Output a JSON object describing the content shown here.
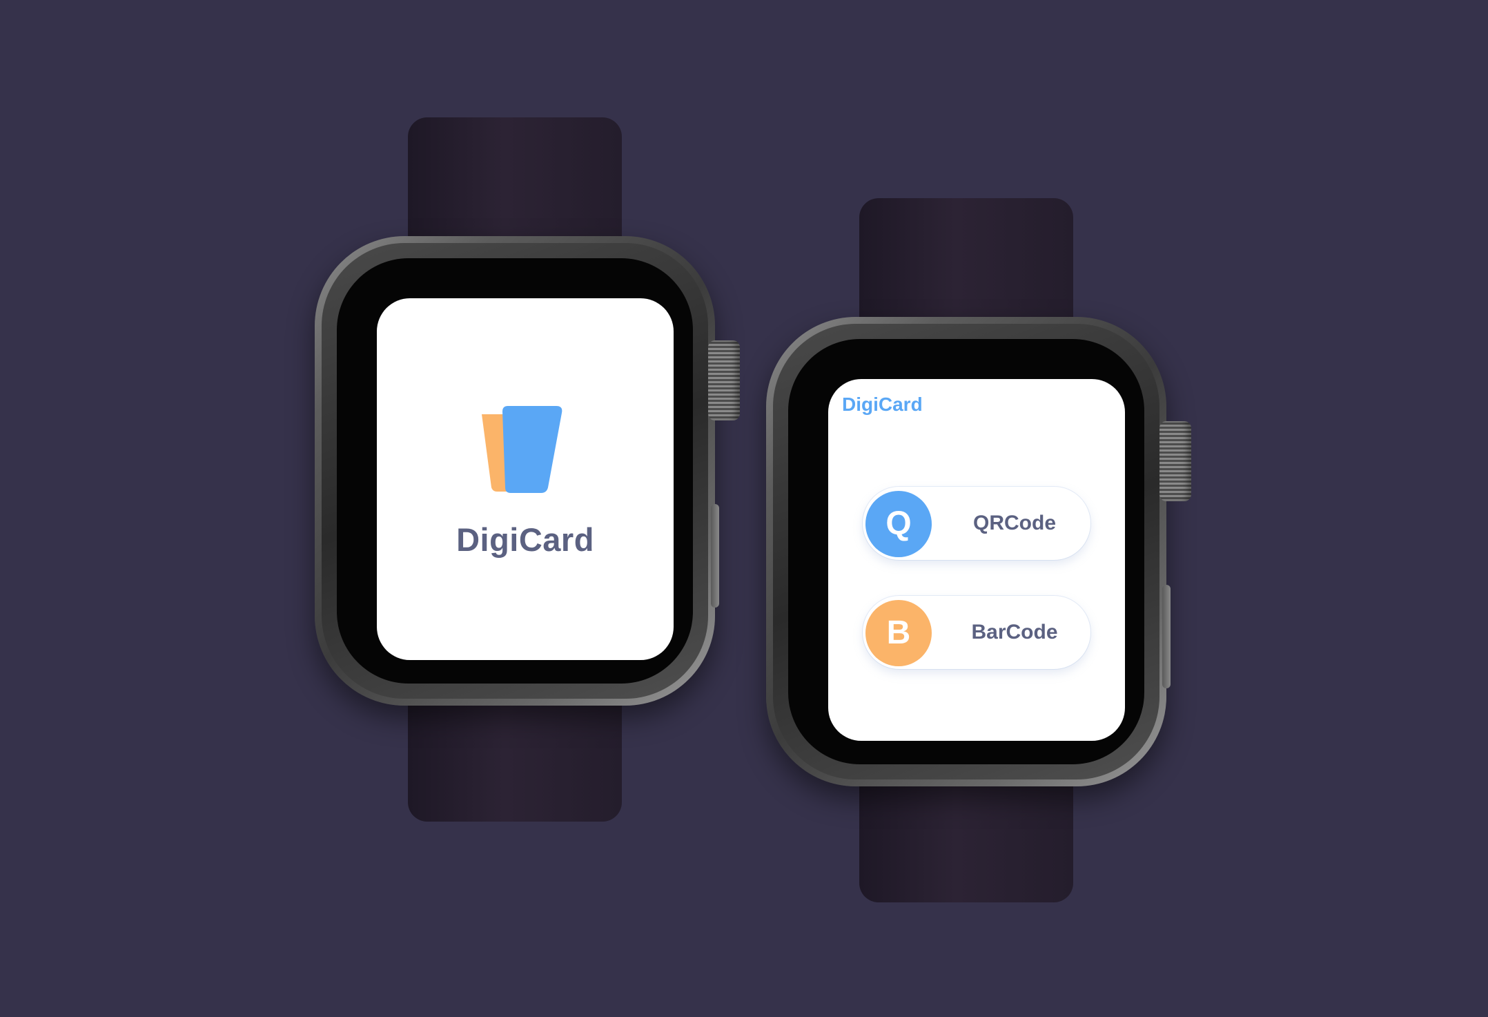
{
  "theme": {
    "background": "#36324b",
    "band_color": "#261f2e",
    "accent_blue": "#5aa7f5",
    "accent_orange": "#fbb469",
    "text_slate": "#5b6181"
  },
  "splash_screen": {
    "logo_icon": "stacked-cards-icon",
    "app_name": "DigiCard"
  },
  "menu_screen": {
    "title": "DigiCard",
    "buttons": [
      {
        "icon_letter": "Q",
        "label": "QRCode",
        "color": "#5aa7f5"
      },
      {
        "icon_letter": "B",
        "label": "BarCode",
        "color": "#fbb469"
      }
    ]
  }
}
